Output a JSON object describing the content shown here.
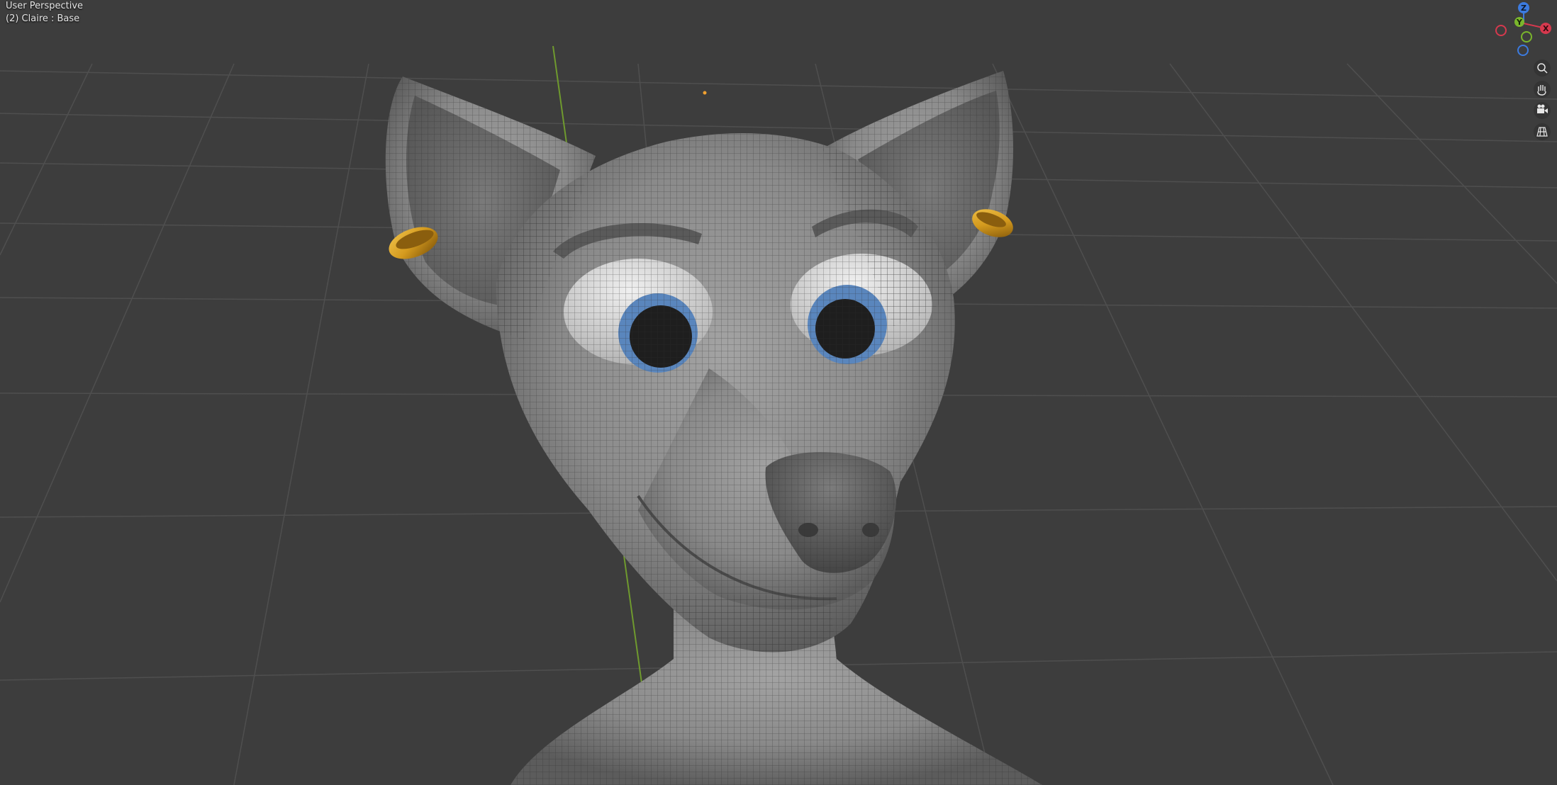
{
  "viewport": {
    "view_name": "User Perspective",
    "object_info": "(2) Claire : Base",
    "background": "#3d3d3d",
    "grid_color": "#4f4f4f",
    "y_axis_color": "#6f9a2e"
  },
  "gizmo": {
    "x_label": "X",
    "y_label": "Y",
    "z_label": "Z",
    "x_color": "#d6394e",
    "y_color": "#7ab62c",
    "z_color": "#3c7be0"
  },
  "nav_buttons": [
    {
      "name": "zoom",
      "icon": "zoom-icon"
    },
    {
      "name": "pan",
      "icon": "hand-icon"
    },
    {
      "name": "camera",
      "icon": "camera-icon"
    },
    {
      "name": "ortho",
      "icon": "grid-icon"
    }
  ],
  "model": {
    "name": "Claire",
    "skin_color": "#8a8a8a",
    "iris_color": "#5a86bd",
    "earring_color": "#d49a1e"
  }
}
